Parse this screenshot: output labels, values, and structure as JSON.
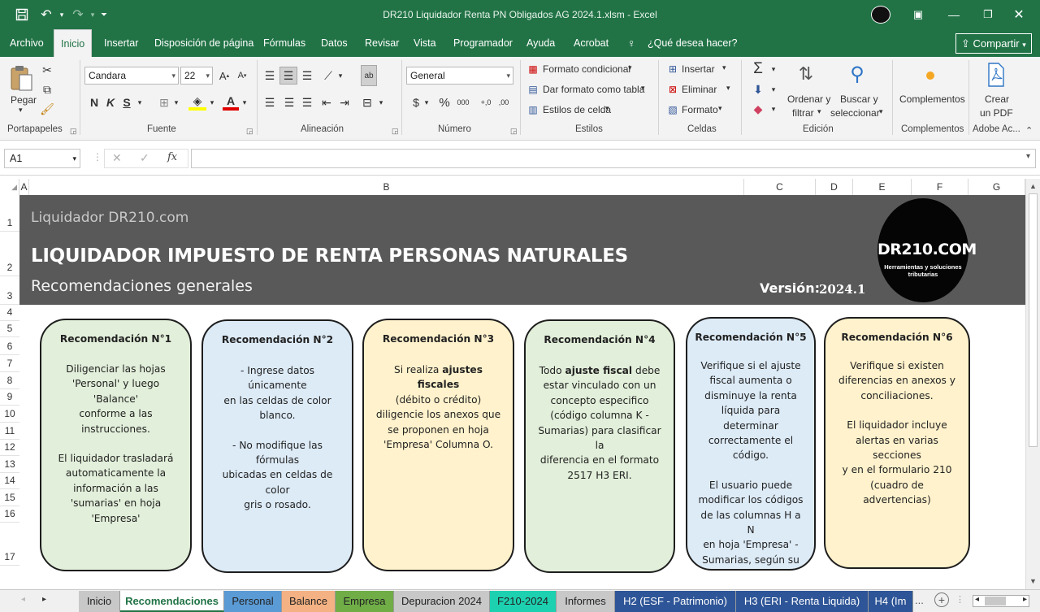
{
  "window": {
    "title": "DR210 Liquidador Renta PN Obligados AG 2024.1.xlsm  -  Excel"
  },
  "ribbon_tabs": [
    "Archivo",
    "Inicio",
    "Insertar",
    "Disposición de página",
    "Fórmulas",
    "Datos",
    "Revisar",
    "Vista",
    "Programador",
    "Ayuda",
    "Acrobat"
  ],
  "tell_me": "¿Qué desea hacer?",
  "share_label": "Compartir",
  "groups": {
    "portapapeles": "Portapapeles",
    "fuente": "Fuente",
    "alineacion": "Alineación",
    "numero": "Número",
    "estilos": "Estilos",
    "celdas": "Celdas",
    "edicion": "Edición",
    "complementos": "Complementos",
    "adobe": "Adobe Ac..."
  },
  "clipboard": {
    "paste": "Pegar"
  },
  "font": {
    "name": "Candara",
    "size": "22",
    "bold": "N",
    "italic": "K",
    "underline": "S"
  },
  "number": {
    "format": "General"
  },
  "styles": {
    "conditional": "Formato condicional",
    "table": "Dar formato como tabla",
    "cell": "Estilos de celda"
  },
  "cells": {
    "insert": "Insertar",
    "delete": "Eliminar",
    "format": "Formato"
  },
  "editing": {
    "sort_l1": "Ordenar y",
    "sort_l2": "filtrar",
    "find_l1": "Buscar y",
    "find_l2": "seleccionar"
  },
  "addins": {
    "label": "Complementos"
  },
  "adobe": {
    "l1": "Crear",
    "l2": "un PDF"
  },
  "namebox": "A1",
  "fx": "fx",
  "columns": [
    "A",
    "B",
    "C",
    "D",
    "E",
    "F",
    "G"
  ],
  "rows": [
    "1",
    "2",
    "3",
    "4",
    "5",
    "6",
    "7",
    "8",
    "9",
    "10",
    "11",
    "12",
    "13",
    "14",
    "15",
    "16",
    "17"
  ],
  "banner": {
    "subtitle": "Liquidador DR210.com",
    "title": "LIQUIDADOR IMPUESTO DE RENTA PERSONAS NATURALES",
    "section": "Recomendaciones generales",
    "version_label": "Versión:",
    "version_value": "2024.1",
    "logo_text": "DR210.COM",
    "logo_sub1": "Herramientas y soluciones",
    "logo_sub2": "tributarias"
  },
  "cards": [
    {
      "title": "Recomendación N°1",
      "color": "#e2efda",
      "paragraphs": [
        [
          "Diligenciar las hojas",
          "'Personal' y luego 'Balance'",
          "conforme a las",
          "instrucciones."
        ],
        [
          "El liquidador trasladará",
          "automaticamente la",
          "información a las",
          "'sumarias' en hoja",
          "'Empresa'"
        ]
      ]
    },
    {
      "title": "Recomendación N°2",
      "color": "#ddebf7",
      "paragraphs": [
        [
          "- Ingrese datos únicamente",
          "en las celdas de color",
          "blanco."
        ],
        [
          "- No modifique las fórmulas",
          "ubicadas en celdas de color",
          "gris o rosado."
        ]
      ]
    },
    {
      "title": "Recomendación N°3",
      "color": "#fff2cc",
      "paragraphs": [
        [
          "Si realiza |ajustes fiscales|",
          "(débito o crédito)",
          "diligencie los anexos que",
          "se proponen en hoja",
          "'Empresa' Columna O."
        ]
      ]
    },
    {
      "title": "Recomendación N°4",
      "color": "#e2efda",
      "paragraphs": [
        [
          "Todo |ajuste fiscal| debe",
          "estar vinculado con un",
          "concepto especifico",
          "(código columna K -",
          "Sumarias) para clasificar la",
          "diferencia en el formato",
          "2517 H3 ERI."
        ]
      ]
    },
    {
      "title": "Recomendación N°5",
      "color": "#ddebf7",
      "paragraphs": [
        [
          "Verifique si el ajuste",
          "fiscal aumenta o",
          "disminuye la renta",
          "líquida para",
          "determinar",
          "correctamente el",
          "código."
        ],
        [
          "El usuario puede",
          "modificar los códigos",
          "de las columnas H a N",
          "en hoja 'Empresa' -",
          "Sumarias, según su"
        ]
      ]
    },
    {
      "title": "Recomendación N°6",
      "color": "#fff2cc",
      "paragraphs": [
        [
          "Verifique si existen",
          "diferencias en anexos y",
          "conciliaciones."
        ],
        [
          "El liquidador incluye",
          "alertas en varias secciones",
          "y en el formulario 210",
          "(cuadro de advertencias)"
        ]
      ]
    }
  ],
  "sheet_tabs": [
    {
      "label": "Inicio",
      "color": "#c8c8c8"
    },
    {
      "label": "Recomendaciones",
      "color": "#ffffff"
    },
    {
      "label": "Personal",
      "color": "#5b9bd5"
    },
    {
      "label": "Balance",
      "color": "#f4b183"
    },
    {
      "label": "Empresa",
      "color": "#70ad47"
    },
    {
      "label": "Depuracion 2024",
      "color": "#c8c8c8"
    },
    {
      "label": "F210-2024",
      "color": "#1dd1b0"
    },
    {
      "label": "Informes",
      "color": "#c8c8c8"
    },
    {
      "label": "H2 (ESF - Patrimonio)",
      "color": "#2e5597"
    },
    {
      "label": "H3 (ERI - Renta Liquida)",
      "color": "#2e5597"
    },
    {
      "label": "H4 (Im",
      "color": "#2e5597"
    }
  ],
  "status_more": "..."
}
